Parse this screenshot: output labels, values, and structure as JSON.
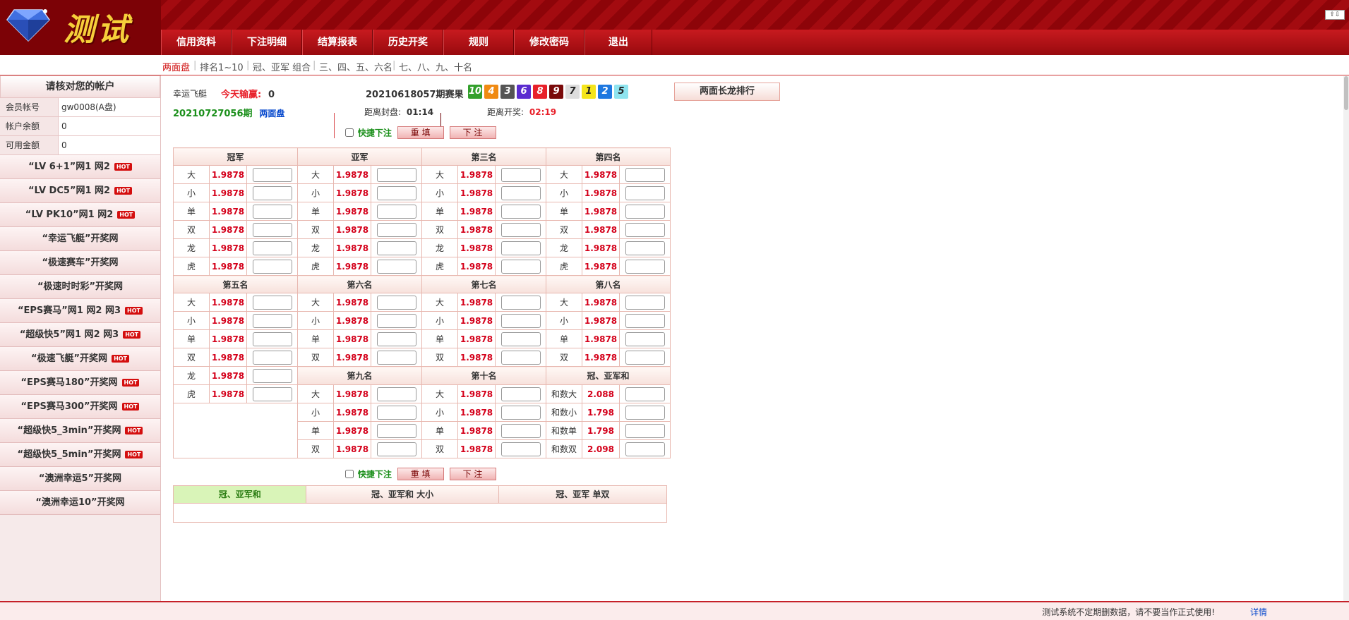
{
  "header": {
    "logo_text": "测试",
    "nav": [
      {
        "label": "幸运飞艇",
        "width": 150
      },
      {
        "label": "信用资料",
        "width": 98
      },
      {
        "label": "下注明细",
        "width": 98
      },
      {
        "label": "结算报表",
        "width": 98
      },
      {
        "label": "历史开奖",
        "width": 98
      },
      {
        "label": "规则",
        "width": 98
      },
      {
        "label": "修改密码",
        "width": 98
      },
      {
        "label": "退出",
        "width": 94
      }
    ],
    "topright_icon": "⇧⇩"
  },
  "subnav": [
    "两面盘",
    "排名1~10",
    "冠、亚军 组合",
    "三、四、五、六名",
    "七、八、九、十名"
  ],
  "sidebar": {
    "title": "请核对您的帐户",
    "account": [
      {
        "k": "会员帐号",
        "v": "gw0008(A盘)"
      },
      {
        "k": "帐户余额",
        "v": "0"
      },
      {
        "k": "可用金额",
        "v": "0"
      }
    ],
    "hot_label": "HOT",
    "items": [
      {
        "label": "“LV 6+1”网1 网2",
        "hot": true
      },
      {
        "label": "“LV DC5”网1 网2",
        "hot": true
      },
      {
        "label": "“LV PK10”网1 网2",
        "hot": true
      },
      {
        "label": "“幸运飞艇”开奖网",
        "hot": false
      },
      {
        "label": "“极速赛车”开奖网",
        "hot": false
      },
      {
        "label": "“极速时时彩”开奖网",
        "hot": false
      },
      {
        "label": "“EPS赛马”网1 网2 网3",
        "hot": true
      },
      {
        "label": "“超级快5”网1 网2 网3",
        "hot": true
      },
      {
        "label": "“极速飞艇”开奖网",
        "hot": true
      },
      {
        "label": "“EPS赛马180”开奖网",
        "hot": true
      },
      {
        "label": "“EPS赛马300”开奖网",
        "hot": true
      },
      {
        "label": "“超级快5_3min”开奖网",
        "hot": true
      },
      {
        "label": "“超级快5_5min”开奖网",
        "hot": true
      },
      {
        "label": "“澳洲幸运5”开奖网",
        "hot": false
      },
      {
        "label": "“澳洲幸运10”开奖网",
        "hot": false
      }
    ]
  },
  "info": {
    "game": "幸运飞艇",
    "today_label": "今天输赢:",
    "today_value": "0",
    "last_period": "20210618057期赛果",
    "period": "20210727056期",
    "pan": "两面盘",
    "close_label": "距离封盘:",
    "close_time": "01:14",
    "open_label": "距离开奖:",
    "open_time": "02:19",
    "rank_button": "两面长龙排行"
  },
  "results": [
    {
      "n": "10",
      "c": "#33a02c"
    },
    {
      "n": "4",
      "c": "#f08a12"
    },
    {
      "n": "3",
      "c": "#555555"
    },
    {
      "n": "6",
      "c": "#5b2cd0"
    },
    {
      "n": "8",
      "c": "#e8202a"
    },
    {
      "n": "9",
      "c": "#7a0a0a"
    },
    {
      "n": "7",
      "c": "#dddddd"
    },
    {
      "n": "1",
      "c": "#f5e51c"
    },
    {
      "n": "2",
      "c": "#1e78e0"
    },
    {
      "n": "5",
      "c": "#8fe4ef"
    }
  ],
  "quick": {
    "label": "快捷下注",
    "reset": "重 填",
    "submit": "下 注"
  },
  "sections": {
    "row1": [
      "冠军",
      "亚军",
      "第三名",
      "第四名"
    ],
    "row2": [
      "第五名",
      "第六名",
      "第七名",
      "第八名"
    ],
    "row3": [
      "第九名",
      "第十名",
      "冠、亚军和"
    ]
  },
  "labels6": [
    "大",
    "小",
    "单",
    "双",
    "龙",
    "虎"
  ],
  "labels4": [
    "大",
    "小",
    "单",
    "双"
  ],
  "odds": "1.9878",
  "sum_bets": [
    {
      "label": "和数大",
      "odds": "2.088"
    },
    {
      "label": "和数小",
      "odds": "1.798"
    },
    {
      "label": "和数单",
      "odds": "1.798"
    },
    {
      "label": "和数双",
      "odds": "2.098"
    }
  ],
  "tabs": [
    {
      "label": "冠、亚军和",
      "width": 188,
      "active": true
    },
    {
      "label": "冠、亚军和 大小",
      "width": 272,
      "active": false
    },
    {
      "label": "冠、亚军 单双",
      "width": 238,
      "active": false
    }
  ],
  "footer": {
    "message": "测试系统不定期删数据，请不要当作正式使用!",
    "link": "详情"
  }
}
